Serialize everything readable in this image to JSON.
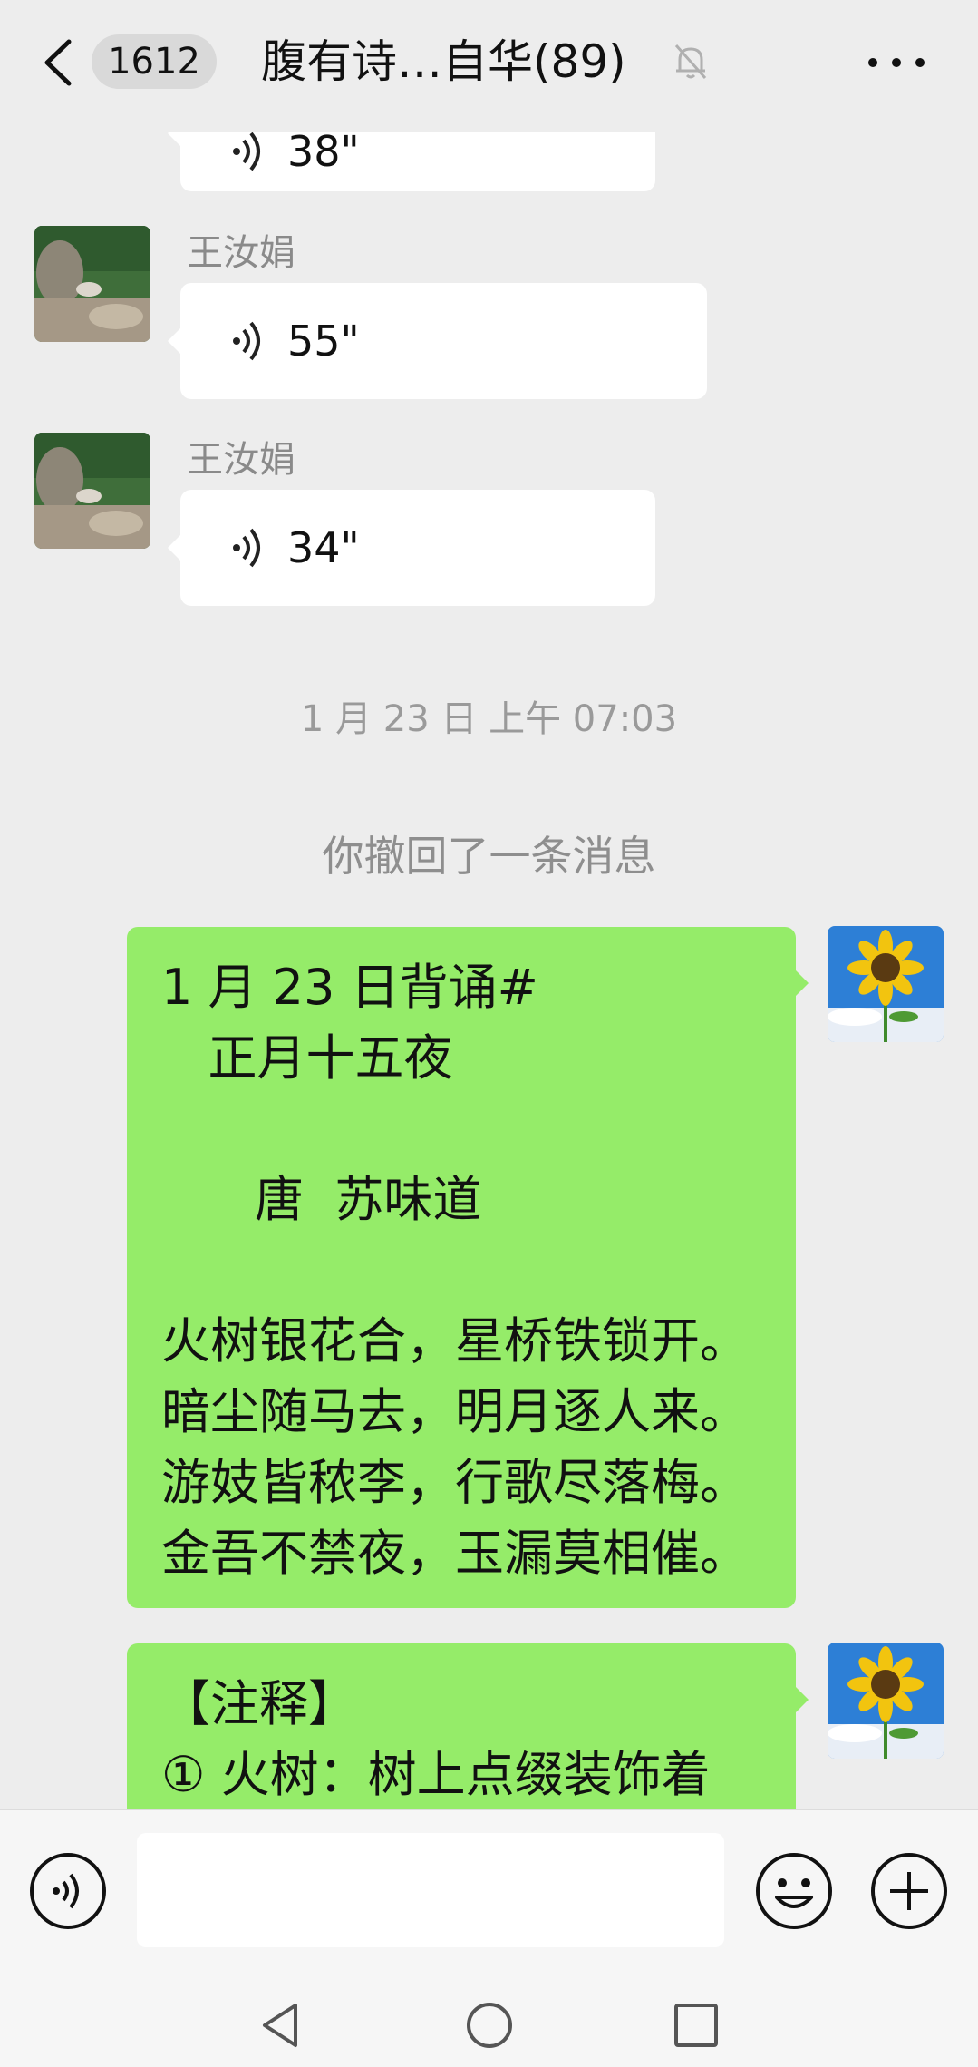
{
  "header": {
    "badge_count": "1612",
    "title": "腹有诗…自华(89)",
    "icons": {
      "back": "back-arrow-icon",
      "mute": "bell-muted-icon",
      "more": "more-dots-icon"
    }
  },
  "messages": [
    {
      "type": "voice",
      "sender": "",
      "duration": "38\"",
      "partial": true
    },
    {
      "type": "voice",
      "sender": "王汝娟",
      "duration": "55\""
    },
    {
      "type": "voice",
      "sender": "王汝娟",
      "duration": "34\""
    }
  ],
  "timestamp": "1 月 23 日 上午 07:03",
  "recall_notice": "你撤回了一条消息",
  "poem_message": {
    "lines": [
      "1 月 23 日背诵#",
      "   正月十五夜",
      "",
      "      唐  苏味道",
      "",
      "火树银花合，星桥铁锁开。",
      "暗尘随马去，明月逐人来。",
      "游妓皆秾李，行歌尽落梅。",
      "金吾不禁夜，玉漏莫相催。"
    ]
  },
  "note_message": {
    "lines": [
      "【注释】",
      "① 火树：树上点缀装饰着"
    ]
  },
  "input_bar": {
    "placeholder": "",
    "icons": {
      "voice": "voice-mode-icon",
      "emoji": "emoji-icon",
      "plus": "plus-icon"
    }
  },
  "nav": {
    "icons": [
      "nav-back-icon",
      "nav-home-icon",
      "nav-recents-icon"
    ]
  },
  "colors": {
    "background": "#ededed",
    "bubble_self": "#95ec69",
    "bubble_other": "#ffffff"
  }
}
